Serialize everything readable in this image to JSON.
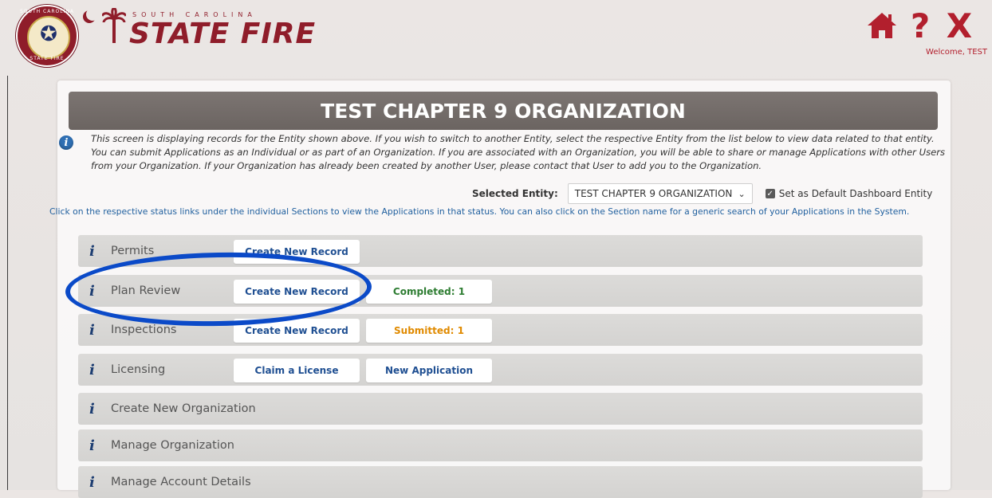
{
  "header": {
    "seal_text_top": "SOUTH CAROLINA",
    "seal_text_bottom": "STATE FIRE",
    "brand_subtitle": "SOUTH CAROLINA",
    "brand_title": "STATE FIRE",
    "help_label": "?",
    "close_label": "X",
    "welcome": "Welcome, TEST"
  },
  "panel": {
    "title": "TEST CHAPTER 9 ORGANIZATION",
    "info_text": "This screen is displaying records for the Entity shown above. If you wish to switch to another Entity, select the respective Entity from the list below to view data related to that entity. You can submit Applications as an Individual or as part of an Organization. If you are associated with an Organization, you will be able to share or manage Applications with other Users from your Organization. If your Organization has already been created by another User, please contact that User to add you to the Organization.",
    "selected_entity_label": "Selected Entity:",
    "selected_entity_value": "TEST CHAPTER 9 ORGANIZATION",
    "default_checkbox_label": "Set as Default Dashboard Entity",
    "note": "Click on the respective status links under the individual Sections to view the Applications in that status. You can also click on the Section name for a generic search of your Applications in the System."
  },
  "sections": [
    {
      "label": "Permits",
      "buttons": [
        "Create New Record"
      ]
    },
    {
      "label": "Plan Review",
      "buttons": [
        "Create New Record",
        "Completed: 1"
      ]
    },
    {
      "label": "Inspections",
      "buttons": [
        "Create New Record",
        "Submitted: 1"
      ]
    },
    {
      "label": "Licensing",
      "buttons": [
        "Claim a License",
        "New Application"
      ]
    },
    {
      "label": "Create New Organization",
      "buttons": []
    },
    {
      "label": "Manage Organization",
      "buttons": []
    },
    {
      "label": "Manage Account Details",
      "buttons": []
    }
  ],
  "colors": {
    "brand_red": "#8f1d2a",
    "link_blue": "#1f4f92",
    "completed_green": "#2e7d32",
    "submitted_orange": "#e08a00",
    "annotation_blue": "#0b4ac8"
  },
  "icons": {
    "home": "home-icon",
    "help": "help-icon",
    "close": "close-icon",
    "info": "info-icon",
    "section_info": "italic-i-icon"
  }
}
